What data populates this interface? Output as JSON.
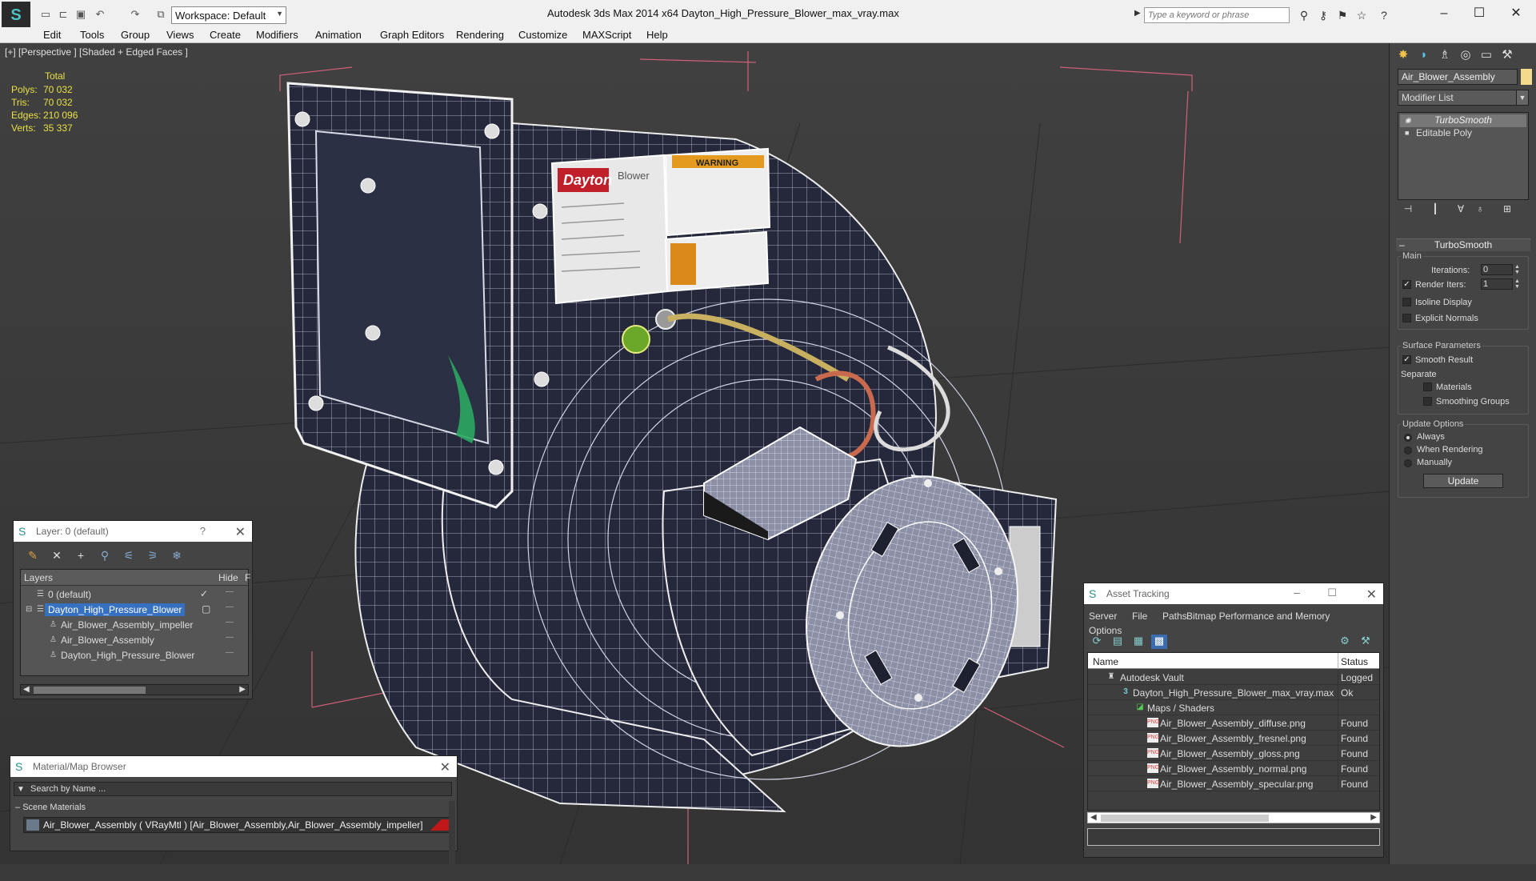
{
  "titlebar": {
    "workspace": "Workspace: Default",
    "title": "Autodesk 3ds Max  2014 x64     Dayton_High_Pressure_Blower_max_vray.max",
    "search_placeholder": "Type a keyword or phrase"
  },
  "menu": [
    "Edit",
    "Tools",
    "Group",
    "Views",
    "Create",
    "Modifiers",
    "Animation",
    "Graph Editors",
    "Rendering",
    "Customize",
    "MAXScript",
    "Help"
  ],
  "viewport": {
    "label": "[+] [Perspective ] [Shaded + Edged Faces ]",
    "stats": {
      "total_label": "Total",
      "rows": [
        {
          "label": "Polys:",
          "value": "70 032"
        },
        {
          "label": "Tris:",
          "value": "70 032"
        },
        {
          "label": "Edges:",
          "value": "210 096"
        },
        {
          "label": "Verts:",
          "value": "35 337"
        }
      ]
    }
  },
  "command_panel": {
    "object_name": "Air_Blower_Assembly",
    "modifier_list": "Modifier List",
    "stack": [
      "TurboSmooth",
      "Editable Poly"
    ],
    "rollout": "TurboSmooth",
    "main_group": "Main",
    "iterations_label": "Iterations:",
    "iterations_value": "0",
    "render_iters_label": "Render Iters:",
    "render_iters_value": "1",
    "isoline_label": "Isoline Display",
    "explicit_label": "Explicit Normals",
    "surface_group": "Surface Parameters",
    "smooth_result_label": "Smooth Result",
    "separate_label": "Separate",
    "materials_label": "Materials",
    "smoothing_groups_label": "Smoothing Groups",
    "update_group": "Update Options",
    "always_label": "Always",
    "when_rendering_label": "When Rendering",
    "manually_label": "Manually",
    "update_button": "Update"
  },
  "layer_panel": {
    "title": "Layer: 0 (default)",
    "help": "?",
    "col_layers": "Layers",
    "col_hide": "Hide",
    "col_f": "F",
    "rows": [
      {
        "name": "0 (default)",
        "indent": 0
      },
      {
        "name": "Dayton_High_Pressure_Blower",
        "indent": 0
      },
      {
        "name": "Air_Blower_Assembly_impeller",
        "indent": 1
      },
      {
        "name": "Air_Blower_Assembly",
        "indent": 1
      },
      {
        "name": "Dayton_High_Pressure_Blower",
        "indent": 1
      }
    ],
    "hide_mark": "—"
  },
  "material_browser": {
    "title": "Material/Map Browser",
    "search_placeholder": "Search by Name ...",
    "section": "Scene Materials",
    "material": "Air_Blower_Assembly  ( VRayMtl ) [Air_Blower_Assembly,Air_Blower_Assembly_impeller]"
  },
  "asset_tracking": {
    "title": "Asset Tracking",
    "menu": [
      "Server",
      "File",
      "Paths",
      "Bitmap Performance and Memory",
      "Options"
    ],
    "col_name": "Name",
    "col_status": "Status",
    "rows": [
      {
        "name": "Autodesk Vault",
        "status": "Logged",
        "indent": 0,
        "icon": "vault-icon"
      },
      {
        "name": "Dayton_High_Pressure_Blower_max_vray.max",
        "status": "Ok",
        "indent": 1,
        "icon": "max-file-icon"
      },
      {
        "name": "Maps / Shaders",
        "status": "",
        "indent": 2,
        "icon": "maps-icon"
      },
      {
        "name": "Air_Blower_Assembly_diffuse.png",
        "status": "Found",
        "indent": 3,
        "icon": "png-icon"
      },
      {
        "name": "Air_Blower_Assembly_fresnel.png",
        "status": "Found",
        "indent": 3,
        "icon": "png-icon"
      },
      {
        "name": "Air_Blower_Assembly_gloss.png",
        "status": "Found",
        "indent": 3,
        "icon": "png-icon"
      },
      {
        "name": "Air_Blower_Assembly_normal.png",
        "status": "Found",
        "indent": 3,
        "icon": "png-icon"
      },
      {
        "name": "Air_Blower_Assembly_specular.png",
        "status": "Found",
        "indent": 3,
        "icon": "png-icon"
      }
    ]
  },
  "scene": {
    "label_brand": "Dayton",
    "label_product": "Blower",
    "label_warning": "WARNING"
  }
}
